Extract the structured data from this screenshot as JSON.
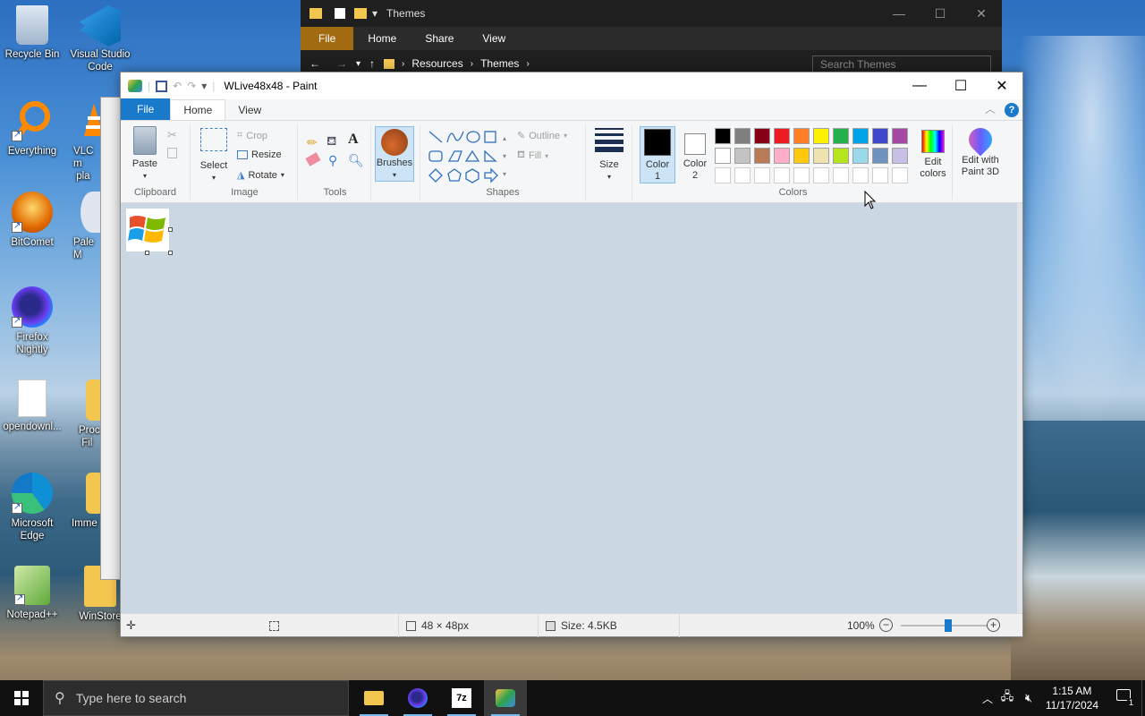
{
  "desktop": {
    "icons": [
      {
        "label": "Recycle Bin"
      },
      {
        "label": "Visual Studio Code"
      },
      {
        "label": "Everything"
      },
      {
        "label": "VLC media player"
      },
      {
        "label": "BitComet"
      },
      {
        "label": "Pale Moon"
      },
      {
        "label": "Firefox Nightly"
      },
      {
        "label": "opendownl..."
      },
      {
        "label": "Process Files"
      },
      {
        "label": "Microsoft Edge"
      },
      {
        "label": "Immersive"
      },
      {
        "label": "Notepad++"
      },
      {
        "label": "WinStore"
      }
    ]
  },
  "explorer": {
    "title": "Themes",
    "tabs": [
      "File",
      "Home",
      "Share",
      "View"
    ],
    "breadcrumb": [
      "Resources",
      "Themes"
    ],
    "search_placeholder": "Search Themes"
  },
  "paint": {
    "title": "WLive48x48 - Paint",
    "tabs": {
      "file": "File",
      "home": "Home",
      "view": "View"
    },
    "clipboard": {
      "paste": "Paste",
      "group": "Clipboard"
    },
    "image": {
      "select": "Select",
      "crop": "Crop",
      "resize": "Resize",
      "rotate": "Rotate",
      "group": "Image"
    },
    "tools": {
      "group": "Tools"
    },
    "brushes": "Brushes",
    "shapes": {
      "outline": "Outline",
      "fill": "Fill",
      "group": "Shapes"
    },
    "size": "Size",
    "colors": {
      "color1": "Color\n1",
      "color1_a": "Color",
      "color1_b": "1",
      "color2_a": "Color",
      "color2_b": "2",
      "edit_a": "Edit",
      "edit_b": "colors",
      "paint3d_a": "Edit with",
      "paint3d_b": "Paint 3D",
      "group": "Colors",
      "palette_row1": [
        "#000000",
        "#7f7f7f",
        "#880015",
        "#ed1c24",
        "#ff7f27",
        "#fff200",
        "#22b14c",
        "#00a2e8",
        "#3f48cc",
        "#a349a4"
      ],
      "palette_row2": [
        "#ffffff",
        "#c3c3c3",
        "#b97a57",
        "#ffaec9",
        "#ffc90e",
        "#efe4b0",
        "#b5e61d",
        "#99d9ea",
        "#7092be",
        "#c8bfe7"
      ],
      "color1_value": "#000000",
      "color2_value": "#ffffff"
    },
    "status": {
      "dimensions": "48 × 48px",
      "size": "Size: 4.5KB",
      "zoom": "100%",
      "zoom_fraction": 0.55
    }
  },
  "taskbar": {
    "search_placeholder": "Type here to search",
    "time": "1:15 AM",
    "date": "11/17/2024",
    "notification_count": "1"
  }
}
